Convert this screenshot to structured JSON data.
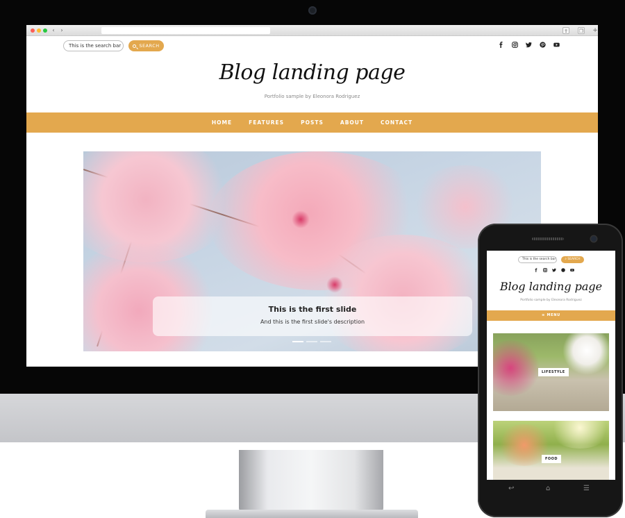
{
  "browser": {
    "back_icon": "chevron-left-icon",
    "forward_icon": "chevron-right-icon",
    "url": ""
  },
  "site": {
    "search": {
      "placeholder": "This is the search bar",
      "button_label": "SEARCH"
    },
    "social_icons": [
      "facebook-icon",
      "instagram-icon",
      "twitter-icon",
      "pinterest-icon",
      "youtube-icon"
    ],
    "title": "Blog landing page",
    "subtitle": "Portfolio sample by Eleonora Rodriguez",
    "menu": [
      "HOME",
      "FEATURES",
      "POSTS",
      "ABOUT",
      "CONTACT"
    ],
    "accent_color": "#e3a84e",
    "slider": {
      "title": "This is the first slide",
      "description": "And this is the first slide's description",
      "slide_count": 3,
      "active_slide": 1
    }
  },
  "mobile": {
    "search": {
      "placeholder": "This is the search bar",
      "button_label": "SEARCH"
    },
    "title": "Blog landing page",
    "subtitle": "Portfolio sample by Eleonora Rodriguez",
    "menu_label": "≡ MENU",
    "cards": [
      {
        "label": "LIFESTYLE"
      },
      {
        "label": "FOOD"
      }
    ],
    "nav_icons": [
      "back-icon",
      "home-icon",
      "recent-apps-icon"
    ]
  }
}
